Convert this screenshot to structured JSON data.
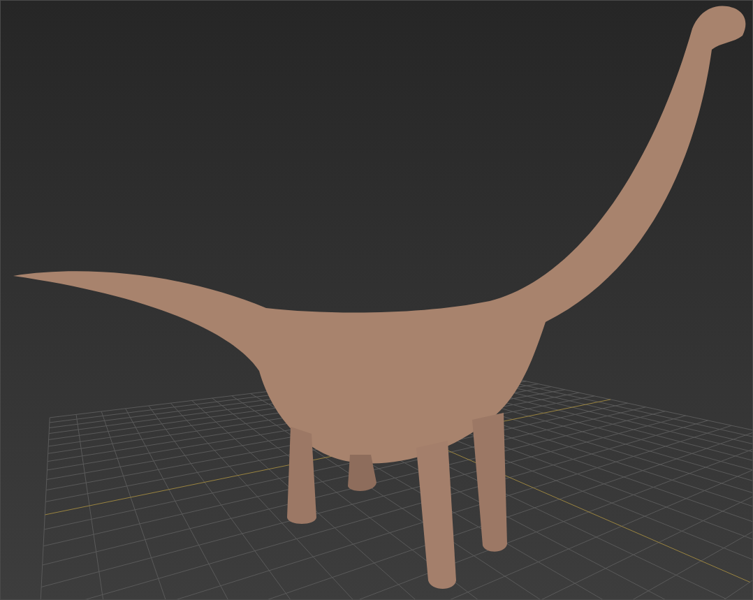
{
  "viewport": {
    "grid_visible": true,
    "model_visible": true
  }
}
